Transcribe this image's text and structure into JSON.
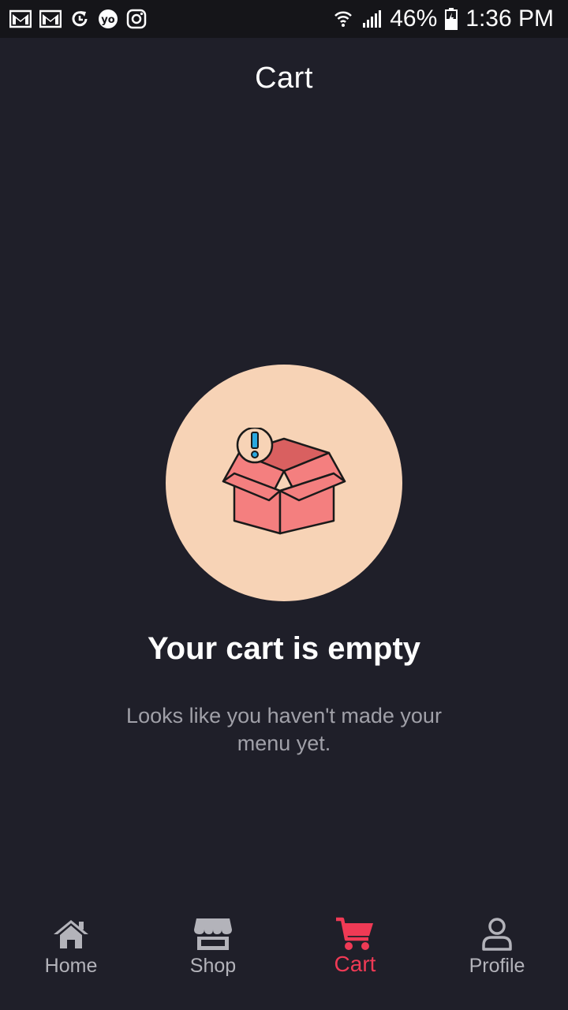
{
  "status_bar": {
    "battery_percent": "46%",
    "time": "1:36 PM",
    "left_icons": [
      "gmail-icon",
      "gmail-icon",
      "sync-icon",
      "yo-icon",
      "instagram-icon"
    ],
    "right_icons": [
      "wifi-icon",
      "signal-icon",
      "battery-icon"
    ]
  },
  "header": {
    "title": "Cart"
  },
  "empty_state": {
    "illustration_icon": "empty-box-icon",
    "title": "Your cart is empty",
    "subtitle": "Looks like you haven't made your menu yet."
  },
  "bottom_nav": {
    "active_color": "#ef3a55",
    "inactive_color": "#b3b3ba",
    "items": [
      {
        "label": "Home",
        "icon": "home-icon",
        "active": false
      },
      {
        "label": "Shop",
        "icon": "shop-icon",
        "active": false
      },
      {
        "label": "Cart",
        "icon": "cart-icon",
        "active": true
      },
      {
        "label": "Profile",
        "icon": "profile-icon",
        "active": false
      }
    ]
  },
  "colors": {
    "background": "#1f1f29",
    "status_bar": "#151519",
    "illustration_circle": "#f7d3b6",
    "box": "#f47f7f",
    "badge": "#29a8e0"
  }
}
